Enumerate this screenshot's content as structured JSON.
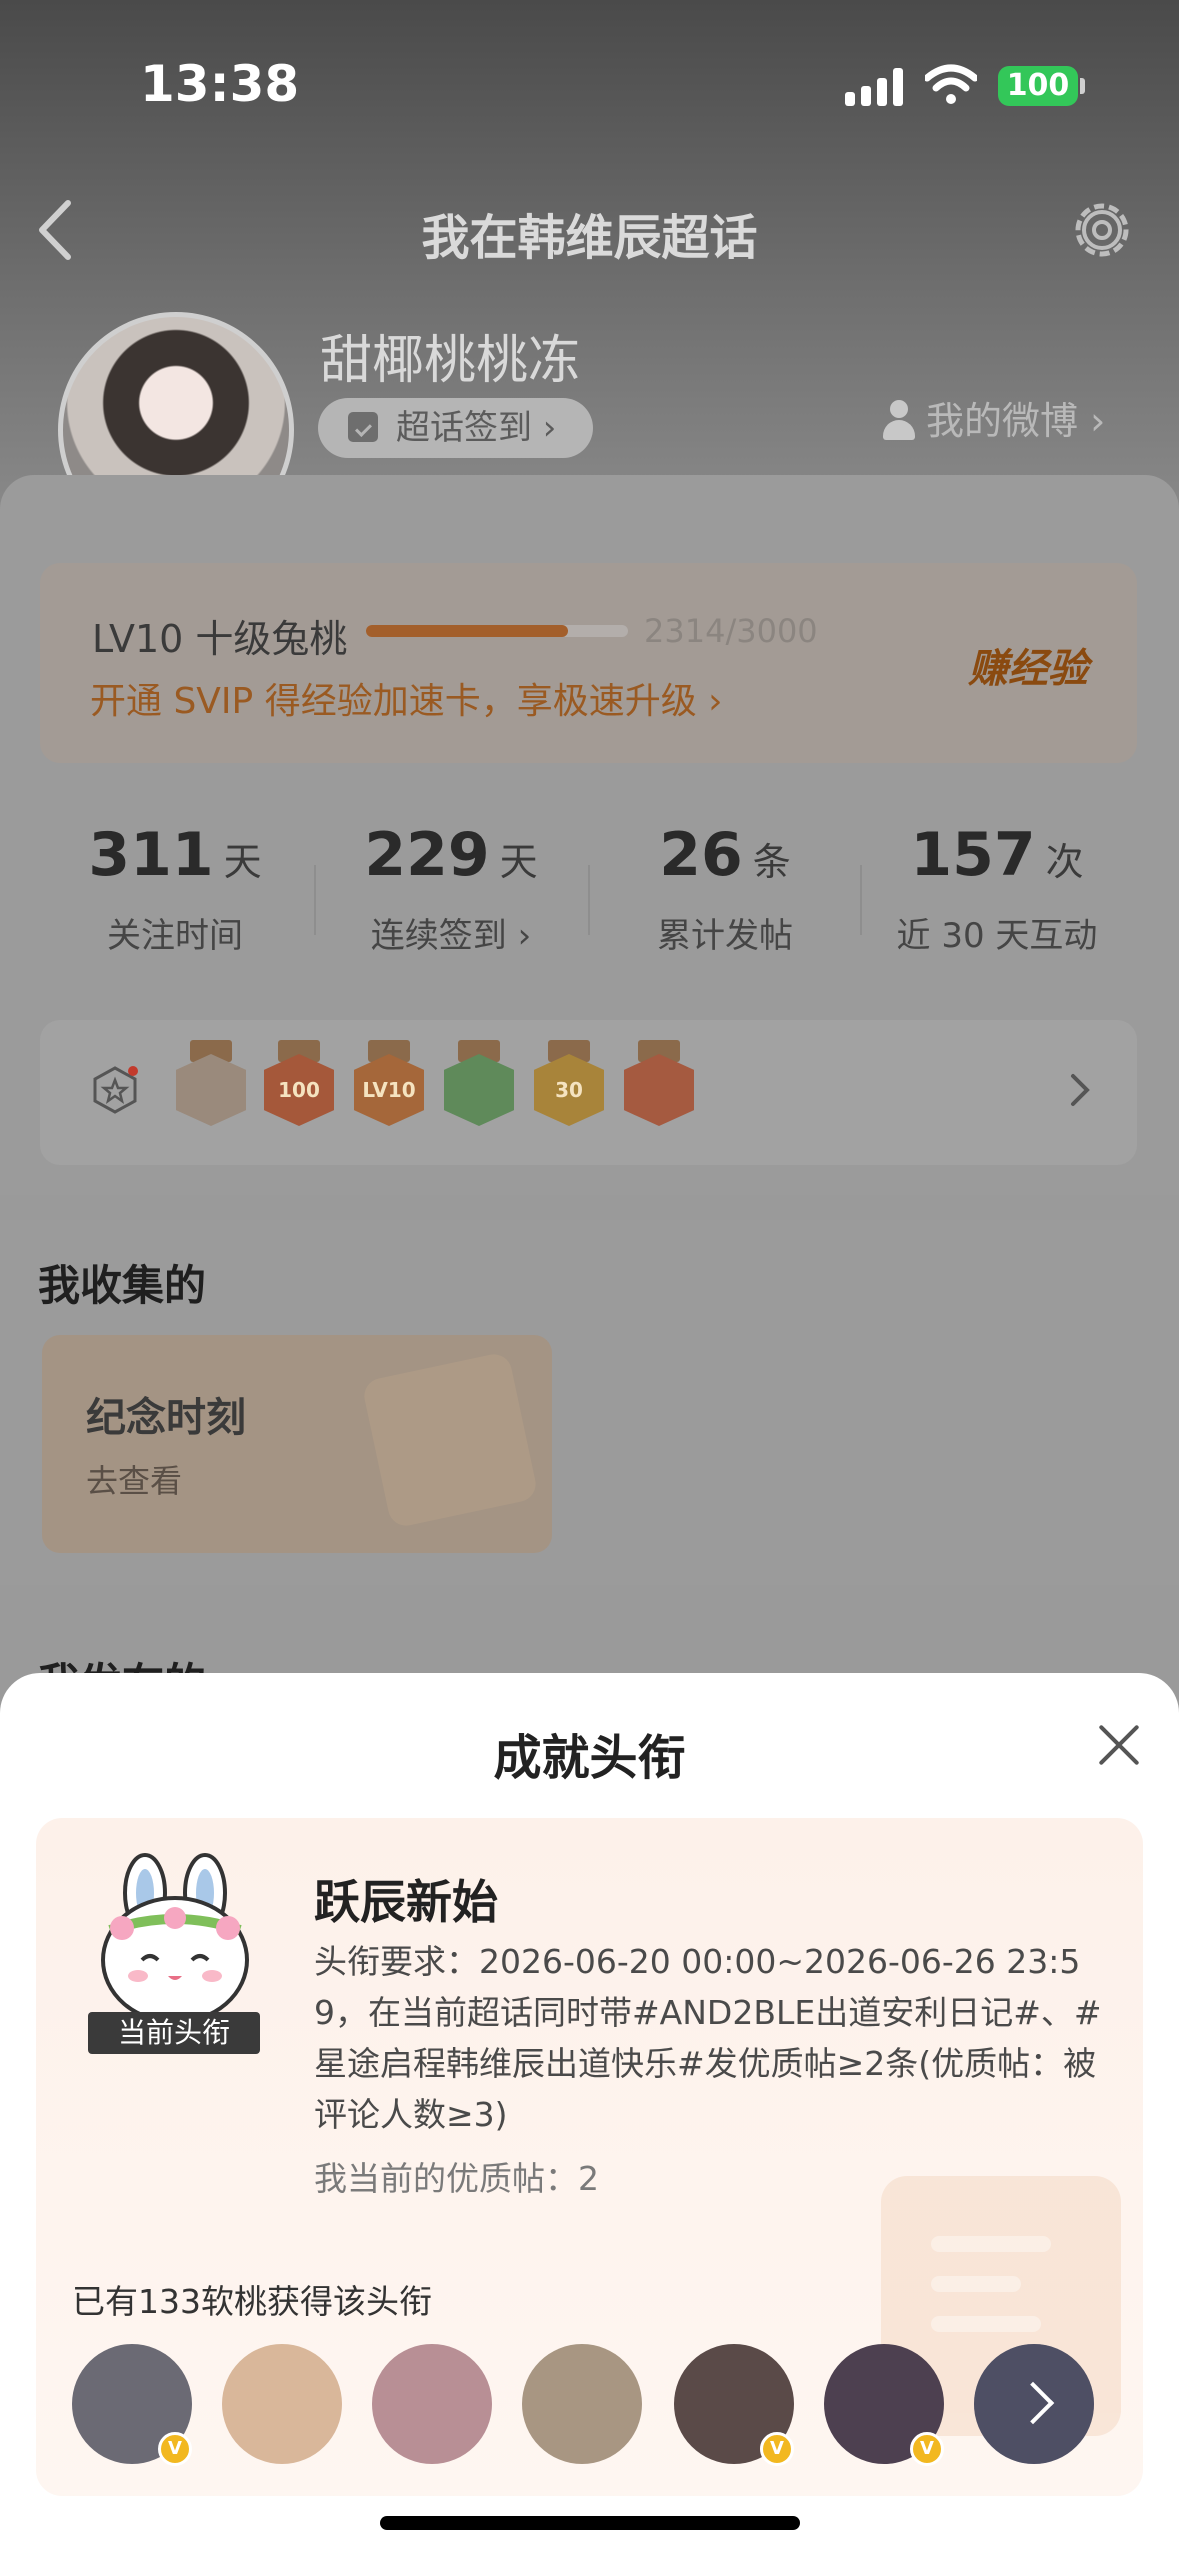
{
  "status_bar": {
    "time": "13:38",
    "battery": "100"
  },
  "nav": {
    "title": "我在韩维辰超话"
  },
  "profile": {
    "username": "甜椰桃桃冻",
    "checkin_label": "超话签到 ›",
    "my_weibo": "我的微博 ›",
    "verified_mark": "V"
  },
  "level": {
    "label": "LV10 十级兔桃",
    "progress": 0.771,
    "exp_text": "2314/3000",
    "svip_text": "开通 SVIP 得经验加速卡，享极速升级 ›",
    "earn_label": "赚经验"
  },
  "stats": [
    {
      "value": "311",
      "unit": "天",
      "label": "关注时间"
    },
    {
      "value": "229",
      "unit": "天",
      "label": "连续签到 ›"
    },
    {
      "value": "26",
      "unit": "条",
      "label": "累计发帖"
    },
    {
      "value": "157",
      "unit": "次",
      "label": "近 30 天互动"
    }
  ],
  "medals": [
    {
      "text": "",
      "color": "#9a8a7c"
    },
    {
      "text": "100",
      "color": "#a5583a"
    },
    {
      "text": "LV10",
      "color": "#a5673a"
    },
    {
      "text": "",
      "color": "#5f8a5a"
    },
    {
      "text": "30",
      "color": "#a8843a"
    },
    {
      "text": "",
      "color": "#a55a40"
    }
  ],
  "collection": {
    "title": "我收集的",
    "card_title": "纪念时刻",
    "card_sub": "去查看"
  },
  "posted": {
    "title": "我发布的"
  },
  "sheet": {
    "title": "成就头衔",
    "current_tag": "当前头衔",
    "achievement_name": "跃辰新始",
    "requirement": "头衔要求：2026-06-20 00:00~2026-06-26 23:59，在当前超话同时带#AND2BLE出道安利日记#、#星途启程韩维辰出道快乐#发优质帖≥2条(优质帖：被评论人数≥3)",
    "my_quality_posts": "我当前的优质帖：2",
    "holders_text": "已有133软桃获得该头衔"
  },
  "holder_avatars": [
    {
      "color": "#6b6a74",
      "verified": true
    },
    {
      "color": "#d9b79a",
      "verified": false
    },
    {
      "color": "#b88f95",
      "verified": false
    },
    {
      "color": "#a89682",
      "verified": false
    },
    {
      "color": "#5a4a48",
      "verified": true
    },
    {
      "color": "#4d4050",
      "verified": true
    },
    {
      "color": "#7d7f95",
      "verified": false
    }
  ]
}
